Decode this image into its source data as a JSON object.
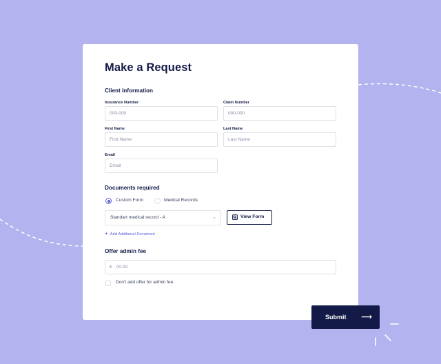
{
  "form": {
    "title": "Make a Request",
    "client_section": "Client information",
    "insurance_label": "Insurance Number",
    "insurance_placeholder": "000-000",
    "claim_label": "Claim Number",
    "claim_placeholder": "000-000",
    "first_label": "First Name",
    "first_placeholder": "First Name",
    "last_label": "Last Name",
    "last_placeholder": "Last Name",
    "email_label": "Email",
    "email_placeholder": "Email",
    "documents_section": "Documents required",
    "radio_custom": "Custom Form",
    "radio_medical": "Medical Records",
    "selected_radio": "Custom Form",
    "doc_select_value": "Standart medical record - A",
    "view_form": "View Form",
    "add_document": "Add Additional Document",
    "fee_section": "Offer admin fee",
    "fee_currency": "£",
    "fee_value": "00.00",
    "no_fee_checkbox": "Don't add offer for admin fee.",
    "no_fee_checked": false,
    "submit": "Submit"
  },
  "colors": {
    "background": "#b3b3ef",
    "navy": "#131a47",
    "accent": "#5b5bd6"
  },
  "icons": {
    "add": "plus-icon",
    "view": "document-search-icon",
    "select": "chevron-down-icon",
    "submit": "arrow-right-icon"
  }
}
